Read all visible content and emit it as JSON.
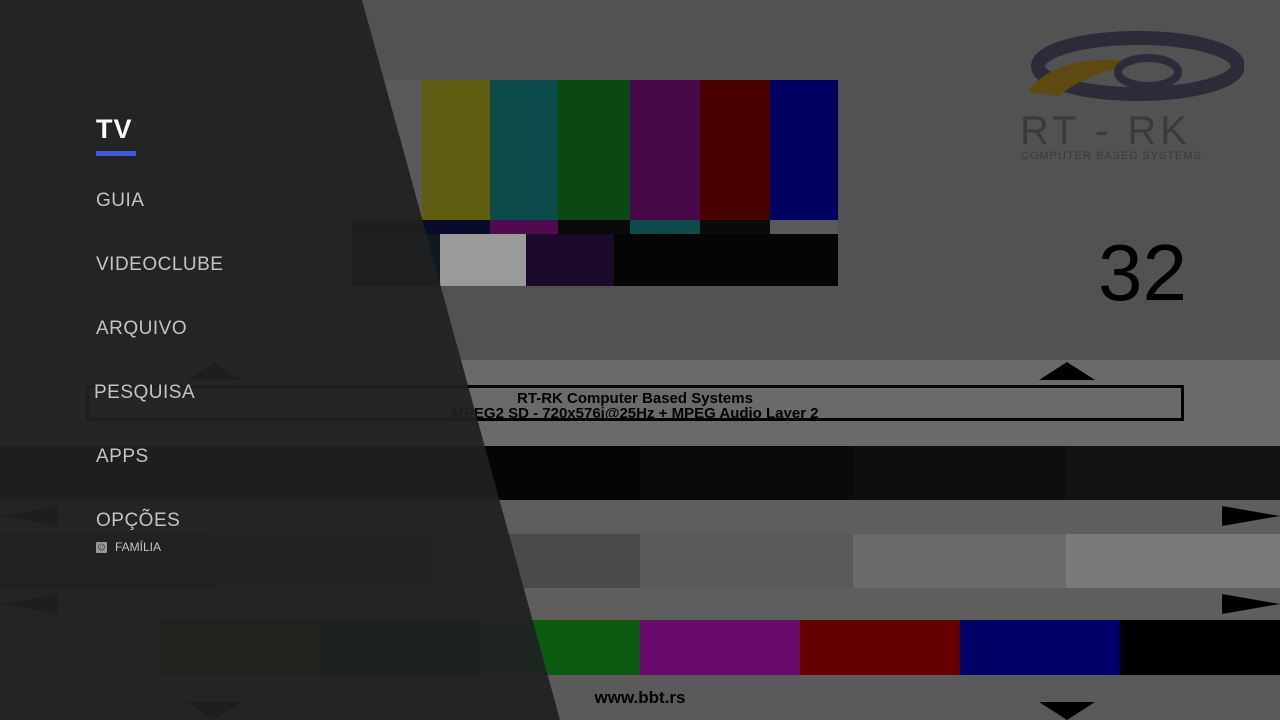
{
  "test_card": {
    "title_line1": "RT-RK Computer Based Systems",
    "title_line2": "MPEG2 SD - 720x576i@25Hz + MPEG Audio Layer 2",
    "url": "www.bbt.rs",
    "channel_number": "32",
    "logo_text": "RT - RK",
    "logo_subtext": "COMPUTER BASED SYSTEMS"
  },
  "menu": {
    "items": [
      {
        "label": "TV",
        "active": true
      },
      {
        "label": "GUIA"
      },
      {
        "label": "VIDEOCLUBE"
      },
      {
        "label": "ARQUIVO"
      },
      {
        "label": "PESQUISA"
      },
      {
        "label": "APPS"
      },
      {
        "label": "OPÇÕES"
      }
    ],
    "profile": {
      "label": "FAMÍLIA",
      "icon": "face-icon"
    },
    "accent_color": "#3b5bdb"
  }
}
